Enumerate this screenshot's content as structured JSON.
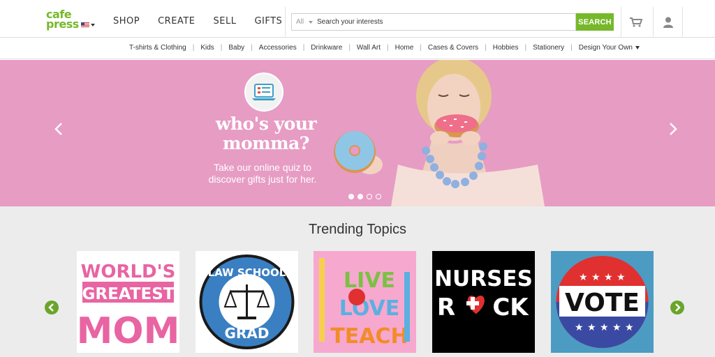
{
  "header": {
    "logo_top": "cafe",
    "logo_bottom": "press",
    "nav": [
      "SHOP",
      "CREATE",
      "SELL",
      "GIFTS"
    ],
    "search_category": "All",
    "search_placeholder": "Search your interests",
    "search_button": "SEARCH",
    "cart_icon": "cart-icon",
    "user_icon": "user-icon"
  },
  "categories": [
    "T-shirts & Clothing",
    "Kids",
    "Baby",
    "Accessories",
    "Drinkware",
    "Wall Art",
    "Home",
    "Cases & Covers",
    "Hobbies",
    "Stationery",
    "Design Your Own"
  ],
  "hero": {
    "title_line1": "who's your",
    "title_line2": "momma?",
    "subtitle_line1": "Take our online quiz to",
    "subtitle_line2": "discover gifts just for her.",
    "slide_count": 4,
    "active_slide": 3
  },
  "trending": {
    "title": "Trending Topics",
    "tiles": [
      {
        "lines": [
          "WORLD'S",
          "GREATEST",
          "MOM"
        ]
      },
      {
        "lines": [
          "LAW SCHOOL",
          "GRAD"
        ]
      },
      {
        "lines": [
          "LIVE",
          "LOVE",
          "TEACH"
        ]
      },
      {
        "lines": [
          "NURSES",
          "R",
          "CK"
        ]
      },
      {
        "lines": [
          "VOTE"
        ]
      }
    ]
  },
  "colors": {
    "brand_green": "#76b82a",
    "hero_pink": "#e79cc4",
    "trending_bg": "#ececec"
  }
}
